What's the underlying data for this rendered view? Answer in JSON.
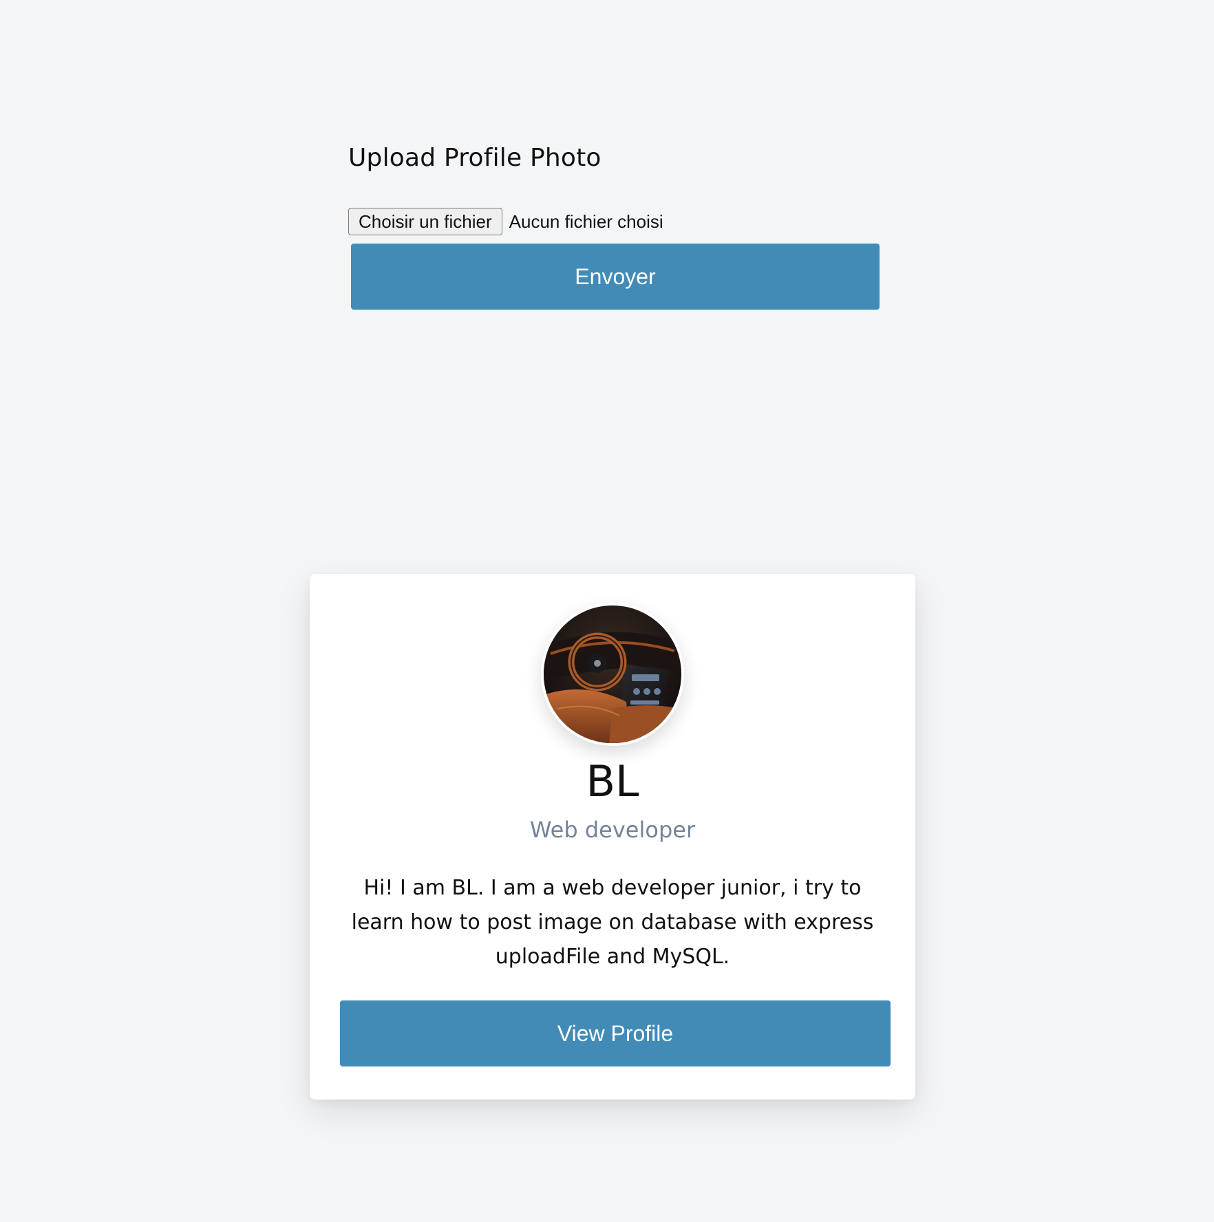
{
  "upload": {
    "title": "Upload Profile Photo",
    "file_button_label": "Choisir un fichier",
    "file_status": "Aucun fichier choisi",
    "submit_label": "Envoyer"
  },
  "profile": {
    "avatar_icon": "car-interior-photo",
    "name": "BL",
    "role": "Web developer",
    "bio": "Hi! I am BL. I am a web developer junior, i try to learn how to post image on database with express uploadFile and MySQL.",
    "view_button_label": "View Profile"
  },
  "colors": {
    "background": "#f4f5f7",
    "accent": "#428bb7",
    "role_text": "#738399",
    "card": "#ffffff"
  }
}
